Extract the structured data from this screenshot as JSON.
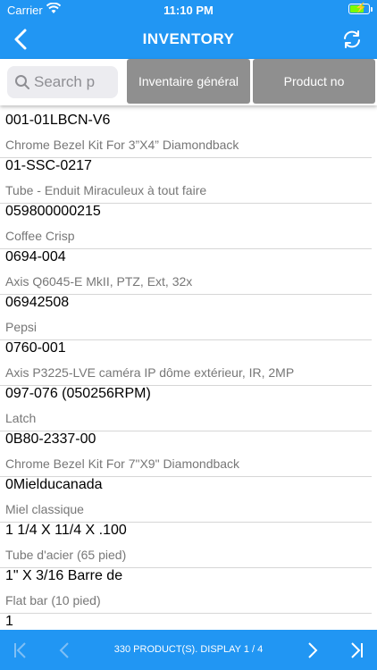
{
  "status_bar": {
    "carrier": "Carrier",
    "time": "11:10 PM"
  },
  "header": {
    "title": "INVENTORY"
  },
  "search": {
    "placeholder": "Search p"
  },
  "tabs": [
    "Inventaire général",
    "Product no"
  ],
  "items": [
    {
      "code": "001-01LBCN-V6",
      "description": "Chrome Bezel Kit For 3”X4” Diamondback"
    },
    {
      "code": "01-SSC-0217",
      "description": "Tube - Enduit Miraculeux à tout faire"
    },
    {
      "code": "059800000215",
      "description": "Coffee Crisp"
    },
    {
      "code": "0694-004",
      "description": "Axis Q6045-E MkII, PTZ, Ext, 32x"
    },
    {
      "code": "06942508",
      "description": "Pepsi"
    },
    {
      "code": "0760-001",
      "description": "Axis P3225-LVE caméra IP dôme extérieur, IR, 2MP"
    },
    {
      "code": "097-076 (050256RPM)",
      "description": "Latch"
    },
    {
      "code": "0B80-2337-00",
      "description": "Chrome Bezel Kit For 7\"X9\" Diamondback"
    },
    {
      "code": "0Mielducanada",
      "description": "Miel classique"
    },
    {
      "code": "1 1/4 X 11/4 X .100",
      "description": "Tube d'acier (65 pied)"
    },
    {
      "code": "1\" X 3/16  Barre de",
      "description": "Flat bar (10 pied)"
    },
    {
      "code": "1 ",
      "description": ""
    }
  ],
  "footer": {
    "info": "330 PRODUCT(S). DISPLAY 1 / 4"
  },
  "colors": {
    "primary": "#2196f3",
    "tab_bg": "#8f8f8f",
    "battery": "#7cfc00"
  },
  "icons": {
    "back": "chevron-left-icon",
    "refresh": "refresh-icon",
    "search": "search-icon",
    "first": "first-page-icon",
    "prev": "prev-page-icon",
    "next": "next-page-icon",
    "last": "last-page-icon"
  }
}
